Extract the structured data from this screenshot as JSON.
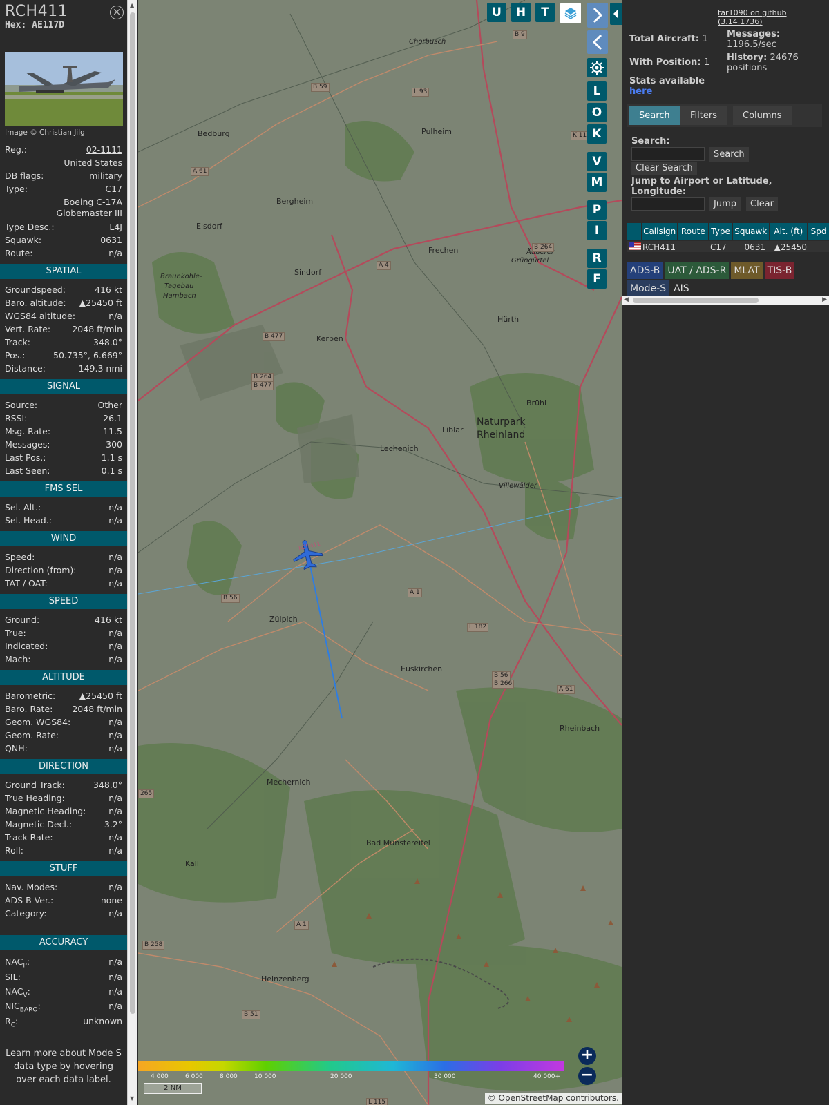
{
  "aircraft": {
    "callsign": "RCH411",
    "hex": "Hex: AE117D",
    "photo_credit": "Image © Christian Jilg",
    "close_label": "×"
  },
  "info": {
    "reg_label": "Reg.:",
    "reg": "02-1111",
    "country": "United States",
    "dbflags_label": "DB flags:",
    "dbflags": "military",
    "type_label": "Type:",
    "type": "C17",
    "type_full_1": "Boeing C-17A",
    "type_full_2": "Globemaster III",
    "typedesc_label": "Type Desc.:",
    "typedesc": "L4J",
    "squawk_label": "Squawk:",
    "squawk": "0631",
    "route_label": "Route:",
    "route": "n/a"
  },
  "sections": {
    "spatial": "SPATIAL",
    "signal": "SIGNAL",
    "fmssel": "FMS SEL",
    "wind": "WIND",
    "speed": "SPEED",
    "altitude": "ALTITUDE",
    "direction": "DIRECTION",
    "stuff": "STUFF",
    "accuracy": "ACCURACY"
  },
  "spatial": [
    {
      "k": "Groundspeed:",
      "v": "416 kt"
    },
    {
      "k": "Baro. altitude:",
      "v": "▲25450 ft"
    },
    {
      "k": "WGS84 altitude:",
      "v": "n/a"
    },
    {
      "k": "Vert. Rate:",
      "v": "2048 ft/min"
    },
    {
      "k": "Track:",
      "v": "348.0°"
    },
    {
      "k": "Pos.:",
      "v": "50.735°, 6.669°"
    },
    {
      "k": "Distance:",
      "v": "149.3 nmi"
    }
  ],
  "signal": [
    {
      "k": "Source:",
      "v": "Other"
    },
    {
      "k": "RSSI:",
      "v": "-26.1"
    },
    {
      "k": "Msg. Rate:",
      "v": "11.5"
    },
    {
      "k": "Messages:",
      "v": "300"
    },
    {
      "k": "Last Pos.:",
      "v": "1.1 s"
    },
    {
      "k": "Last Seen:",
      "v": "0.1 s"
    }
  ],
  "fmssel": [
    {
      "k": "Sel. Alt.:",
      "v": "n/a"
    },
    {
      "k": "Sel. Head.:",
      "v": "n/a"
    }
  ],
  "wind": [
    {
      "k": "Speed:",
      "v": "n/a"
    },
    {
      "k": "Direction (from):",
      "v": "n/a"
    },
    {
      "k": "TAT / OAT:",
      "v": "n/a"
    }
  ],
  "speed": [
    {
      "k": "Ground:",
      "v": "416 kt"
    },
    {
      "k": "True:",
      "v": "n/a"
    },
    {
      "k": "Indicated:",
      "v": "n/a"
    },
    {
      "k": "Mach:",
      "v": "n/a"
    }
  ],
  "altitude": [
    {
      "k": "Barometric:",
      "v": "▲25450 ft"
    },
    {
      "k": "Baro. Rate:",
      "v": "2048 ft/min"
    },
    {
      "k": "Geom. WGS84:",
      "v": "n/a"
    },
    {
      "k": "Geom. Rate:",
      "v": "n/a"
    },
    {
      "k": "QNH:",
      "v": "n/a"
    }
  ],
  "direction": [
    {
      "k": "Ground Track:",
      "v": "348.0°"
    },
    {
      "k": "True Heading:",
      "v": "n/a"
    },
    {
      "k": "Magnetic Heading:",
      "v": "n/a"
    },
    {
      "k": "Magnetic Decl.:",
      "v": "3.2°"
    },
    {
      "k": "Track Rate:",
      "v": "n/a"
    },
    {
      "k": "Roll:",
      "v": "n/a"
    }
  ],
  "stuff": [
    {
      "k": "Nav. Modes:",
      "v": "n/a"
    },
    {
      "k": "ADS-B Ver.:",
      "v": "none"
    },
    {
      "k": "Category:",
      "v": "n/a"
    }
  ],
  "accuracy": {
    "nacp": "NAC",
    "nacp_sub": "P",
    "nacp_v": "n/a",
    "sil": "SIL:",
    "sil_v": "n/a",
    "nacv": "NAC",
    "nacv_sub": "V",
    "nacv_v": "n/a",
    "nicbaro": "NIC",
    "nicbaro_sub": "BARO",
    "nicbaro_v": "n/a",
    "rc": "R",
    "rc_sub": "C",
    "rc_v": "unknown",
    "colon": ":"
  },
  "learn_more": "Learn more about Mode S data type by hovering over each data label.",
  "map": {
    "buttons": [
      "U",
      "H",
      "T"
    ],
    "side_buttons": [
      "L",
      "O",
      "K",
      "V",
      "M",
      "P",
      "I",
      "R",
      "F"
    ],
    "zoom_in": "+",
    "zoom_out": "−",
    "scale": "2 NM",
    "attribution": "© OpenStreetMap contributors.",
    "legend_ticks": [
      "4 000",
      "6 000",
      "8 000",
      "10 000",
      "20 000",
      "30 000",
      "40 000+"
    ],
    "towns": [
      {
        "n": "Bedburg"
      },
      {
        "n": "Pulheim"
      },
      {
        "n": "Bergheim"
      },
      {
        "n": "Elsdorf"
      },
      {
        "n": "Sindorf"
      },
      {
        "n": "Frechen"
      },
      {
        "n": "Kerpen"
      },
      {
        "n": "Hürth"
      },
      {
        "n": "Brühl"
      },
      {
        "n": "Liblar"
      },
      {
        "n": "Lechenich"
      },
      {
        "n": "Naturpark"
      },
      {
        "n": "Rheinland"
      },
      {
        "n": "Zülpich"
      },
      {
        "n": "Euskirchen"
      },
      {
        "n": "Rheinbach"
      },
      {
        "n": "Mechernich"
      },
      {
        "n": "Bad Münstereifel"
      },
      {
        "n": "Kall"
      },
      {
        "n": "Heinzenberg"
      },
      {
        "n": "Braunkohle-"
      },
      {
        "n": "Tagebau"
      },
      {
        "n": "Hambach"
      },
      {
        "n": "Villewälder"
      },
      {
        "n": "Äußerer"
      },
      {
        "n": "Grüngürtel"
      },
      {
        "n": "Chorbusch"
      }
    ],
    "roads": [
      "B 59",
      "L 93",
      "B 9",
      "A 61",
      "K 11",
      "B 264",
      "A 4",
      "B 477",
      "B 264",
      "B 477",
      "B 56",
      "A 1",
      "L 182",
      "B 56",
      "B 266",
      "A 61",
      "B 258",
      "B 51",
      "L 115",
      "A 1",
      "265"
    ],
    "flight_label": "RCH411"
  },
  "right": {
    "github": "tar1090 on github (3.14.1736)",
    "total_label": "Total Aircraft:",
    "total": "1",
    "withpos_label": "With Position:",
    "withpos": "1",
    "messages_label": "Messages:",
    "messages": "1196.5/sec",
    "history_label": "History:",
    "history": "24676 positions",
    "stats_label": "Stats available",
    "stats_link": "here",
    "tabs": [
      "Search",
      "Filters",
      "Columns"
    ],
    "search_label": "Search:",
    "search_placeholder": "",
    "search_btn": "Search",
    "clear_search_btn": "Clear Search",
    "jump_label": "Jump to Airport or Latitude, Longitude:",
    "jump_btn": "Jump",
    "clear_btn": "Clear",
    "table_headers": [
      "Callsign",
      "Route",
      "Type",
      "Squawk",
      "Alt. (ft)",
      "Spd"
    ],
    "table_row": {
      "callsign": "RCH411",
      "route": "",
      "type": "C17",
      "squawk": "0631",
      "alt": "▲25450"
    },
    "sources": [
      "ADS-B",
      "UAT / ADS-R",
      "MLAT",
      "TIS-B",
      "Mode-S",
      "AIS"
    ]
  }
}
